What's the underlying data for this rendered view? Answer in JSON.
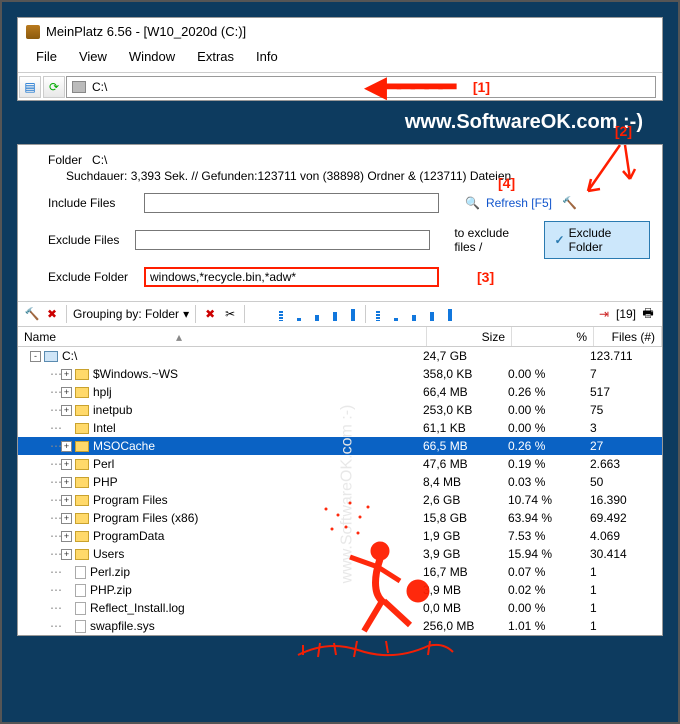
{
  "title": "MeinPlatz 6.56 - [W10_2020d (C:)]",
  "menu": {
    "file": "File",
    "view": "View",
    "window": "Window",
    "extras": "Extras",
    "info": "Info"
  },
  "address": "C:\\",
  "markers": {
    "m1": "[1]",
    "m2": "[2]",
    "m3": "[3]",
    "m4": "[4]"
  },
  "url": "www.SoftwareOK.com :-)",
  "folder_label": "Folder",
  "folder_path": "C:\\",
  "stats": "Suchdauer: 3,393 Sek. //  Gefunden:123711 von (38898) Ordner & (123711) Dateien",
  "labels": {
    "include": "Include Files",
    "excludeF": "Exclude Files",
    "excludeD": "Exclude Folder"
  },
  "exclude_folder_val": "windows,*recycle.bin,*adw*",
  "refresh": "Refresh [F5]",
  "to_exclude": "to exclude files / ",
  "exclude_btn": "Exclude Folder",
  "grouping": "Grouping by: Folder",
  "toolbar_count": "[19]",
  "headers": {
    "name": "Name",
    "size": "Size",
    "pct": "%",
    "files": "Files (#)"
  },
  "rows": [
    {
      "pad": 12,
      "plus": "-",
      "icon": "drive",
      "name": "C:\\",
      "size": "24,7 GB",
      "pct": "",
      "files": "123.711"
    },
    {
      "pad": 32,
      "plus": "+",
      "icon": "fold",
      "name": "$Windows.~WS",
      "size": "358,0 KB",
      "pct": "0.00 %",
      "files": "7"
    },
    {
      "pad": 32,
      "plus": "+",
      "icon": "fold",
      "name": "hplj",
      "size": "66,4 MB",
      "pct": "0.26 %",
      "files": "517"
    },
    {
      "pad": 32,
      "plus": "+",
      "icon": "fold",
      "name": "inetpub",
      "size": "253,0 KB",
      "pct": "0.00 %",
      "files": "75"
    },
    {
      "pad": 32,
      "plus": "",
      "icon": "fold",
      "name": "Intel",
      "size": "61,1 KB",
      "pct": "0.00 %",
      "files": "3"
    },
    {
      "pad": 32,
      "plus": "+",
      "icon": "fold",
      "name": "MSOCache",
      "size": "66,5 MB",
      "pct": "0.26 %",
      "files": "27",
      "sel": true
    },
    {
      "pad": 32,
      "plus": "+",
      "icon": "fold",
      "name": "Perl",
      "size": "47,6 MB",
      "pct": "0.19 %",
      "files": "2.663"
    },
    {
      "pad": 32,
      "plus": "+",
      "icon": "fold",
      "name": "PHP",
      "size": "8,4 MB",
      "pct": "0.03 %",
      "files": "50"
    },
    {
      "pad": 32,
      "plus": "+",
      "icon": "fold",
      "name": "Program Files",
      "size": "2,6 GB",
      "pct": "10.74 %",
      "files": "16.390"
    },
    {
      "pad": 32,
      "plus": "+",
      "icon": "fold",
      "name": "Program Files (x86)",
      "size": "15,8 GB",
      "pct": "63.94 %",
      "files": "69.492"
    },
    {
      "pad": 32,
      "plus": "+",
      "icon": "fold",
      "name": "ProgramData",
      "size": "1,9 GB",
      "pct": "7.53 %",
      "files": "4.069"
    },
    {
      "pad": 32,
      "plus": "+",
      "icon": "fold",
      "name": "Users",
      "size": "3,9 GB",
      "pct": "15.94 %",
      "files": "30.414"
    },
    {
      "pad": 32,
      "plus": "",
      "icon": "file",
      "name": "Perl.zip",
      "size": "16,7 MB",
      "pct": "0.07 %",
      "files": "1"
    },
    {
      "pad": 32,
      "plus": "",
      "icon": "file",
      "name": "PHP.zip",
      "size": "3,9 MB",
      "pct": "0.02 %",
      "files": "1"
    },
    {
      "pad": 32,
      "plus": "",
      "icon": "file",
      "name": "Reflect_Install.log",
      "size": "0,0 MB",
      "pct": "0.00 %",
      "files": "1"
    },
    {
      "pad": 32,
      "plus": "",
      "icon": "file",
      "name": "swapfile.sys",
      "size": "256,0 MB",
      "pct": "1.01 %",
      "files": "1"
    }
  ]
}
